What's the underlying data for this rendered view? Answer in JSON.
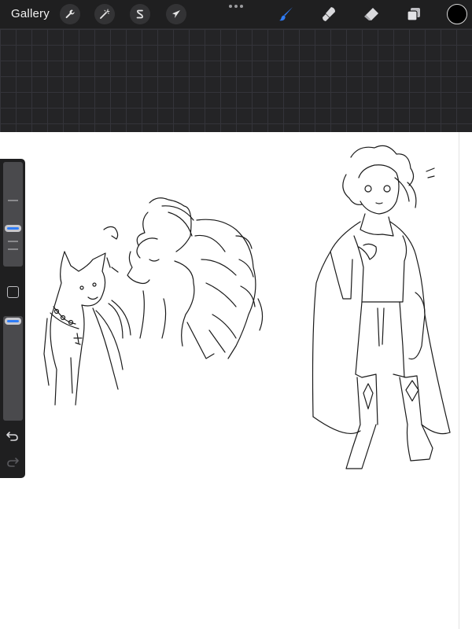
{
  "toolbar": {
    "gallery_label": "Gallery",
    "actions_icon": "wrench-icon",
    "adjustments_icon": "magic-wand-icon",
    "selection_icon": "selection-s-icon",
    "transform_icon": "cursor-arrow-icon",
    "more_icon": "more-dots-icon",
    "brush_icon": "brush-icon",
    "smudge_icon": "smudge-icon",
    "eraser_icon": "eraser-icon",
    "layers_icon": "layers-icon",
    "current_color": "#000000",
    "active_tool": "brush",
    "accent_color": "#2f7cf6"
  },
  "sidebar": {
    "brush_size_level": 0.45,
    "opacity_level": 0.97,
    "modify_icon": "square-icon",
    "undo_icon": "undo-icon",
    "redo_icon": "redo-icon"
  },
  "canvas": {
    "background": "#ffffff",
    "content": "pencil-sketch"
  }
}
